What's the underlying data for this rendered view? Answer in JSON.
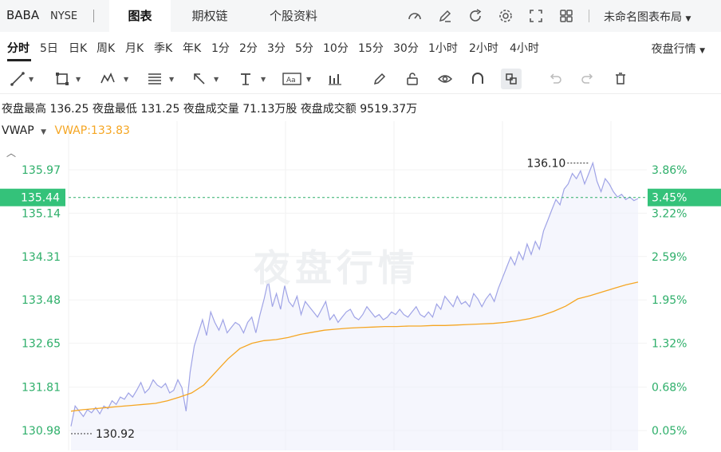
{
  "header": {
    "ticker": "BABA",
    "exchange": "NYSE",
    "tabs": [
      {
        "label": "图表",
        "active": true
      },
      {
        "label": "期权链",
        "active": false
      },
      {
        "label": "个股资料",
        "active": false
      }
    ],
    "layout_name": "未命名图表布局",
    "icons": [
      "gauge-icon",
      "pen-icon",
      "refresh-icon",
      "gear-icon",
      "fullscreen-icon",
      "grid-icon"
    ]
  },
  "periods": {
    "items": [
      "分时",
      "5日",
      "日K",
      "周K",
      "月K",
      "季K",
      "年K",
      "1分",
      "2分",
      "3分",
      "5分",
      "10分",
      "15分",
      "30分",
      "1小时",
      "2小时",
      "4小时"
    ],
    "active": "分时",
    "session": "夜盘行情"
  },
  "toolbar": {
    "icons": [
      "line-tool-icon",
      "rect-tool-icon",
      "pattern-tool-icon",
      "fib-tool-icon",
      "arrow-tool-icon",
      "text-tool-icon",
      "label-tool-icon",
      "indicator-icon",
      "brush-icon",
      "lock-icon",
      "eye-icon",
      "magnet-icon",
      "link-icon",
      "undo-icon",
      "redo-icon",
      "delete-icon"
    ]
  },
  "info": {
    "high_label": "夜盘最高",
    "high": "136.25",
    "low_label": "夜盘最低",
    "low": "131.25",
    "vol_label": "夜盘成交量",
    "vol": "71.13万股",
    "amt_label": "夜盘成交额",
    "amt": "9519.37万"
  },
  "vwap": {
    "name": "VWAP",
    "value": "VWAP:133.83"
  },
  "watermark": "夜盘行情",
  "chart_data": {
    "type": "area",
    "ylim": [
      130.6,
      136.9
    ],
    "y_ticks_left": [
      "135.97",
      "135.14",
      "134.31",
      "133.48",
      "132.65",
      "131.81",
      "130.98"
    ],
    "y_ticks_right": [
      "3.86%",
      "3.22%",
      "2.59%",
      "1.95%",
      "1.32%",
      "0.68%",
      "0.05%"
    ],
    "current_price": "135.44",
    "current_pct": "3.45%",
    "max_label": "136.10",
    "min_label": "130.92",
    "grid": true,
    "series": [
      {
        "name": "price",
        "color": "#9fa3e6",
        "values": [
          131.06,
          131.45,
          131.35,
          131.25,
          131.38,
          131.32,
          131.42,
          131.3,
          131.45,
          131.4,
          131.55,
          131.48,
          131.62,
          131.58,
          131.7,
          131.62,
          131.75,
          131.9,
          131.7,
          131.78,
          131.95,
          131.85,
          131.8,
          131.88,
          131.7,
          131.75,
          131.95,
          131.8,
          131.35,
          132.1,
          132.6,
          132.85,
          133.1,
          132.8,
          133.25,
          133.05,
          132.9,
          133.1,
          132.85,
          132.95,
          133.05,
          133.0,
          132.85,
          133.05,
          133.15,
          132.85,
          133.2,
          133.5,
          133.85,
          133.35,
          133.6,
          133.3,
          133.75,
          133.45,
          133.35,
          133.55,
          133.2,
          133.45,
          133.35,
          133.25,
          133.15,
          133.3,
          133.45,
          133.1,
          133.2,
          133.05,
          133.15,
          133.25,
          133.3,
          133.15,
          133.1,
          133.2,
          133.35,
          133.25,
          133.15,
          133.2,
          133.1,
          133.15,
          133.25,
          133.2,
          133.3,
          133.2,
          133.15,
          133.25,
          133.35,
          133.2,
          133.15,
          133.25,
          133.15,
          133.4,
          133.3,
          133.55,
          133.45,
          133.35,
          133.55,
          133.4,
          133.45,
          133.35,
          133.6,
          133.5,
          133.35,
          133.5,
          133.6,
          133.45,
          133.7,
          133.9,
          134.1,
          134.3,
          134.15,
          134.4,
          134.25,
          134.55,
          134.35,
          134.6,
          134.45,
          134.8,
          135.0,
          135.2,
          135.4,
          135.3,
          135.6,
          135.7,
          135.9,
          135.8,
          135.95,
          135.7,
          135.9,
          136.1,
          135.75,
          135.55,
          135.8,
          135.7,
          135.55,
          135.45,
          135.5,
          135.4,
          135.45,
          135.38,
          135.42
        ]
      },
      {
        "name": "VWAP",
        "color": "#f5a623",
        "values": [
          131.35,
          131.38,
          131.4,
          131.42,
          131.44,
          131.46,
          131.48,
          131.5,
          131.55,
          131.62,
          131.7,
          131.85,
          132.1,
          132.35,
          132.55,
          132.65,
          132.7,
          132.72,
          132.76,
          132.82,
          132.86,
          132.9,
          132.92,
          132.94,
          132.95,
          132.96,
          132.97,
          132.97,
          132.98,
          132.98,
          132.99,
          132.99,
          133.0,
          133.01,
          133.02,
          133.03,
          133.05,
          133.08,
          133.12,
          133.18,
          133.26,
          133.36,
          133.5,
          133.56,
          133.63,
          133.7,
          133.77,
          133.82
        ]
      }
    ]
  }
}
